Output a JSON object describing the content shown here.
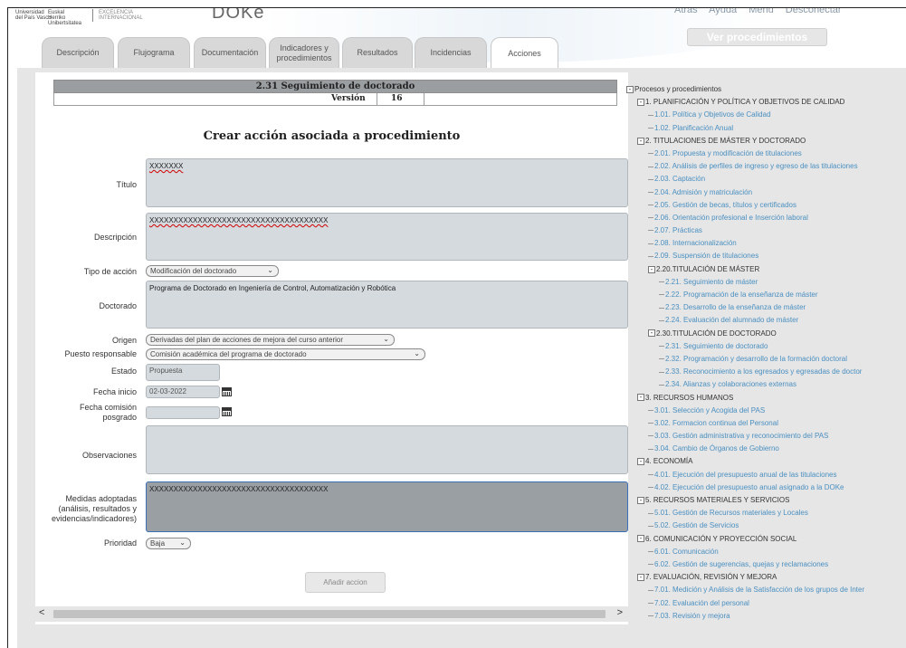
{
  "header": {
    "logo_line1a": "Universidad",
    "logo_line1b": "del País Vasco",
    "logo_line2a": "Euskal Herriko",
    "logo_line2b": "Unibertsitatea",
    "logo_line3a": "EXCELENCIA",
    "logo_line3b": "INTERNACIONAL",
    "app_title": "DOKe",
    "links": [
      "Atrás",
      "Ayuda",
      "Menú",
      "Desconectar"
    ],
    "ver_procedimientos": "Ver procedimientos"
  },
  "tabs": [
    {
      "label": "Descripción",
      "active": false
    },
    {
      "label": "Flujograma",
      "active": false
    },
    {
      "label": "Documentación",
      "active": false
    },
    {
      "label": "Indicadores y procedimientos",
      "active": false
    },
    {
      "label": "Resultados",
      "active": false
    },
    {
      "label": "Incidencias",
      "active": false
    },
    {
      "label": "Acciones",
      "active": true
    }
  ],
  "procedure": {
    "title": "2.31 Seguimiento de doctorado",
    "version_label": "Versión",
    "version_value": "16"
  },
  "form": {
    "title": "Crear acción asociada a procedimiento",
    "titulo_label": "Título",
    "titulo_value": "XXXXXXX",
    "descripcion_label": "Descripción",
    "descripcion_value": "XXXXXXXXXXXXXXXXXXXXXXXXXXXXXXXXXXXXX",
    "tipo_label": "Tipo de acción",
    "tipo_value": "Modificación del doctorado",
    "doctorado_label": "Doctorado",
    "doctorado_value": "Programa de Doctorado en Ingeniería de Control, Automatización y Robótica",
    "origen_label": "Origen",
    "origen_value": "Derivadas del plan de acciones de mejora del curso anterior",
    "puesto_label": "Puesto responsable",
    "puesto_value": "Comisión académica del programa de doctorado",
    "estado_label": "Estado",
    "estado_value": "Propuesta",
    "fecha_inicio_label": "Fecha inicio",
    "fecha_inicio_value": "02-03-2022",
    "fecha_comision_label1": "Fecha comisión",
    "fecha_comision_label2": "posgrado",
    "fecha_comision_value": "",
    "observaciones_label": "Observaciones",
    "observaciones_value": "",
    "medidas_label1": "Medidas adoptadas",
    "medidas_label2": "(análisis, resultados y",
    "medidas_label3": "evidencias/indicadores)",
    "medidas_value": "XXXXXXXXXXXXXXXXXXXXXXXXXXXXXXXXXXXXX",
    "prioridad_label": "Prioridad",
    "prioridad_value": "Baja",
    "submit_label": "Añadir accion"
  },
  "scroll": {
    "left_arrow": "<",
    "right_arrow": ">"
  },
  "tree": [
    {
      "level": 0,
      "toggle": "-",
      "text": "Procesos y procedimientos",
      "type": "cat"
    },
    {
      "level": 1,
      "toggle": "-",
      "text": "1. PLANIFICACIÓN Y POLÍTICA Y OBJETIVOS DE CALIDAD",
      "type": "cat"
    },
    {
      "level": 2,
      "toggle": "",
      "text": "1.01. Política y Objetivos de Calidad",
      "type": "leaf"
    },
    {
      "level": 2,
      "toggle": "",
      "text": "1.02. Planificación Anual",
      "type": "leaf"
    },
    {
      "level": 1,
      "toggle": "-",
      "text": "2. TITULACIONES DE MÁSTER Y DOCTORADO",
      "type": "cat"
    },
    {
      "level": 2,
      "toggle": "",
      "text": "2.01. Propuesta y modificación de titulaciones",
      "type": "leaf"
    },
    {
      "level": 2,
      "toggle": "",
      "text": "2.02. Análisis de perfiles de ingreso y egreso de las titulaciones",
      "type": "leaf"
    },
    {
      "level": 2,
      "toggle": "",
      "text": "2.03. Captación",
      "type": "leaf"
    },
    {
      "level": 2,
      "toggle": "",
      "text": "2.04. Admisión y matriculación",
      "type": "leaf"
    },
    {
      "level": 2,
      "toggle": "",
      "text": "2.05. Gestión de becas, títulos y certificados",
      "type": "leaf"
    },
    {
      "level": 2,
      "toggle": "",
      "text": "2.06. Orientación profesional e Inserción laboral",
      "type": "leaf"
    },
    {
      "level": 2,
      "toggle": "",
      "text": "2.07. Prácticas",
      "type": "leaf"
    },
    {
      "level": 2,
      "toggle": "",
      "text": "2.08. Internacionalización",
      "type": "leaf"
    },
    {
      "level": 2,
      "toggle": "",
      "text": "2.09. Suspensión de titulaciones",
      "type": "leaf"
    },
    {
      "level": 2,
      "toggle": "-",
      "text": "2.20.TITULACIÓN DE MÁSTER",
      "type": "cat"
    },
    {
      "level": 3,
      "toggle": "",
      "text": "2.21. Seguimiento de máster",
      "type": "leaf"
    },
    {
      "level": 3,
      "toggle": "",
      "text": "2.22. Programación de la enseñanza de máster",
      "type": "leaf"
    },
    {
      "level": 3,
      "toggle": "",
      "text": "2.23. Desarrollo de la enseñanza de máster",
      "type": "leaf"
    },
    {
      "level": 3,
      "toggle": "",
      "text": "2.24. Evaluación del alumnado de máster",
      "type": "leaf"
    },
    {
      "level": 2,
      "toggle": "-",
      "text": "2.30.TITULACIÓN DE DOCTORADO",
      "type": "cat"
    },
    {
      "level": 3,
      "toggle": "",
      "text": "2.31. Seguimiento de doctorado",
      "type": "leaf"
    },
    {
      "level": 3,
      "toggle": "",
      "text": "2.32. Programación y desarrollo de la formación doctoral",
      "type": "leaf"
    },
    {
      "level": 3,
      "toggle": "",
      "text": "2.33. Reconocimiento a los egresados y egresadas de doctor",
      "type": "leaf"
    },
    {
      "level": 3,
      "toggle": "",
      "text": "2.34. Alianzas y colaboraciones externas",
      "type": "leaf"
    },
    {
      "level": 1,
      "toggle": "-",
      "text": "3. RECURSOS HUMANOS",
      "type": "cat"
    },
    {
      "level": 2,
      "toggle": "",
      "text": "3.01. Selección y Acogida del PAS",
      "type": "leaf"
    },
    {
      "level": 2,
      "toggle": "",
      "text": "3.02. Formacion continua del Personal",
      "type": "leaf"
    },
    {
      "level": 2,
      "toggle": "",
      "text": "3.03. Gestión administrativa y reconocimiento del PAS",
      "type": "leaf"
    },
    {
      "level": 2,
      "toggle": "",
      "text": "3.04. Cambio de Órganos de Gobierno",
      "type": "leaf"
    },
    {
      "level": 1,
      "toggle": "-",
      "text": "4. ECONOMÍA",
      "type": "cat"
    },
    {
      "level": 2,
      "toggle": "",
      "text": "4.01. Ejecución del presupuesto anual de las titulaciones",
      "type": "leaf"
    },
    {
      "level": 2,
      "toggle": "",
      "text": "4.02. Ejecución del presupuesto anual asignado a la DOKe",
      "type": "leaf"
    },
    {
      "level": 1,
      "toggle": "-",
      "text": "5. RECURSOS MATERIALES Y SERVICIOS",
      "type": "cat"
    },
    {
      "level": 2,
      "toggle": "",
      "text": "5.01. Gestión de Recursos materiales y Locales",
      "type": "leaf"
    },
    {
      "level": 2,
      "toggle": "",
      "text": "5.02. Gestión de Servicios",
      "type": "leaf"
    },
    {
      "level": 1,
      "toggle": "-",
      "text": "6. COMUNICACIÓN Y PROYECCIÓN SOCIAL",
      "type": "cat"
    },
    {
      "level": 2,
      "toggle": "",
      "text": "6.01. Comunicación",
      "type": "leaf"
    },
    {
      "level": 2,
      "toggle": "",
      "text": "6.02. Gestión de sugerencias, quejas y reclamaciones",
      "type": "leaf"
    },
    {
      "level": 1,
      "toggle": "-",
      "text": "7. EVALUACIÓN, REVISIÓN Y MEJORA",
      "type": "cat"
    },
    {
      "level": 2,
      "toggle": "",
      "text": "7.01. Medición y Análisis de la Satisfacción de los grupos de Inter",
      "type": "leaf"
    },
    {
      "level": 2,
      "toggle": "",
      "text": "7.02. Evaluación del personal",
      "type": "leaf"
    },
    {
      "level": 2,
      "toggle": "",
      "text": "7.03. Revisión y mejora",
      "type": "leaf"
    }
  ]
}
